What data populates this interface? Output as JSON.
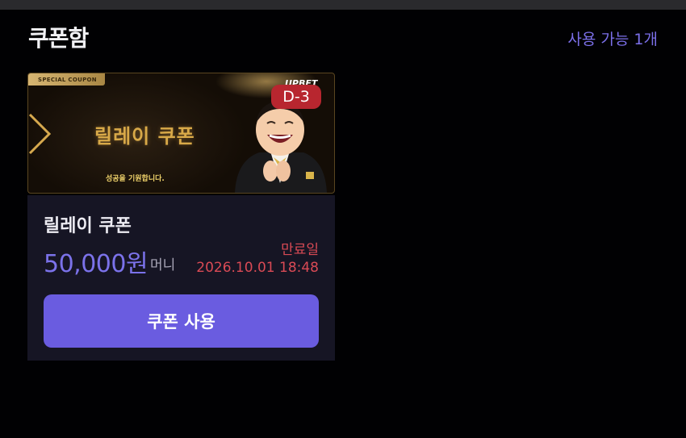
{
  "header": {
    "title": "쿠폰함",
    "available": "사용 가능 1개"
  },
  "coupon": {
    "banner": {
      "tag": "SPECIAL COUPON",
      "title": "릴레이 쿠폰",
      "subtitle": "성공을 기원합니다.",
      "brand": "UPBET",
      "dday": "D-3"
    },
    "name": "릴레이 쿠폰",
    "amount": "50,000원",
    "unit": "머니",
    "expire_label": "만료일",
    "expire_date": "2026.10.01 18:48",
    "button_label": "쿠폰 사용"
  },
  "colors": {
    "accent": "#6a5ce0",
    "amount": "#7b72ea",
    "expire": "#d94a55",
    "badge": "#b8262f"
  }
}
